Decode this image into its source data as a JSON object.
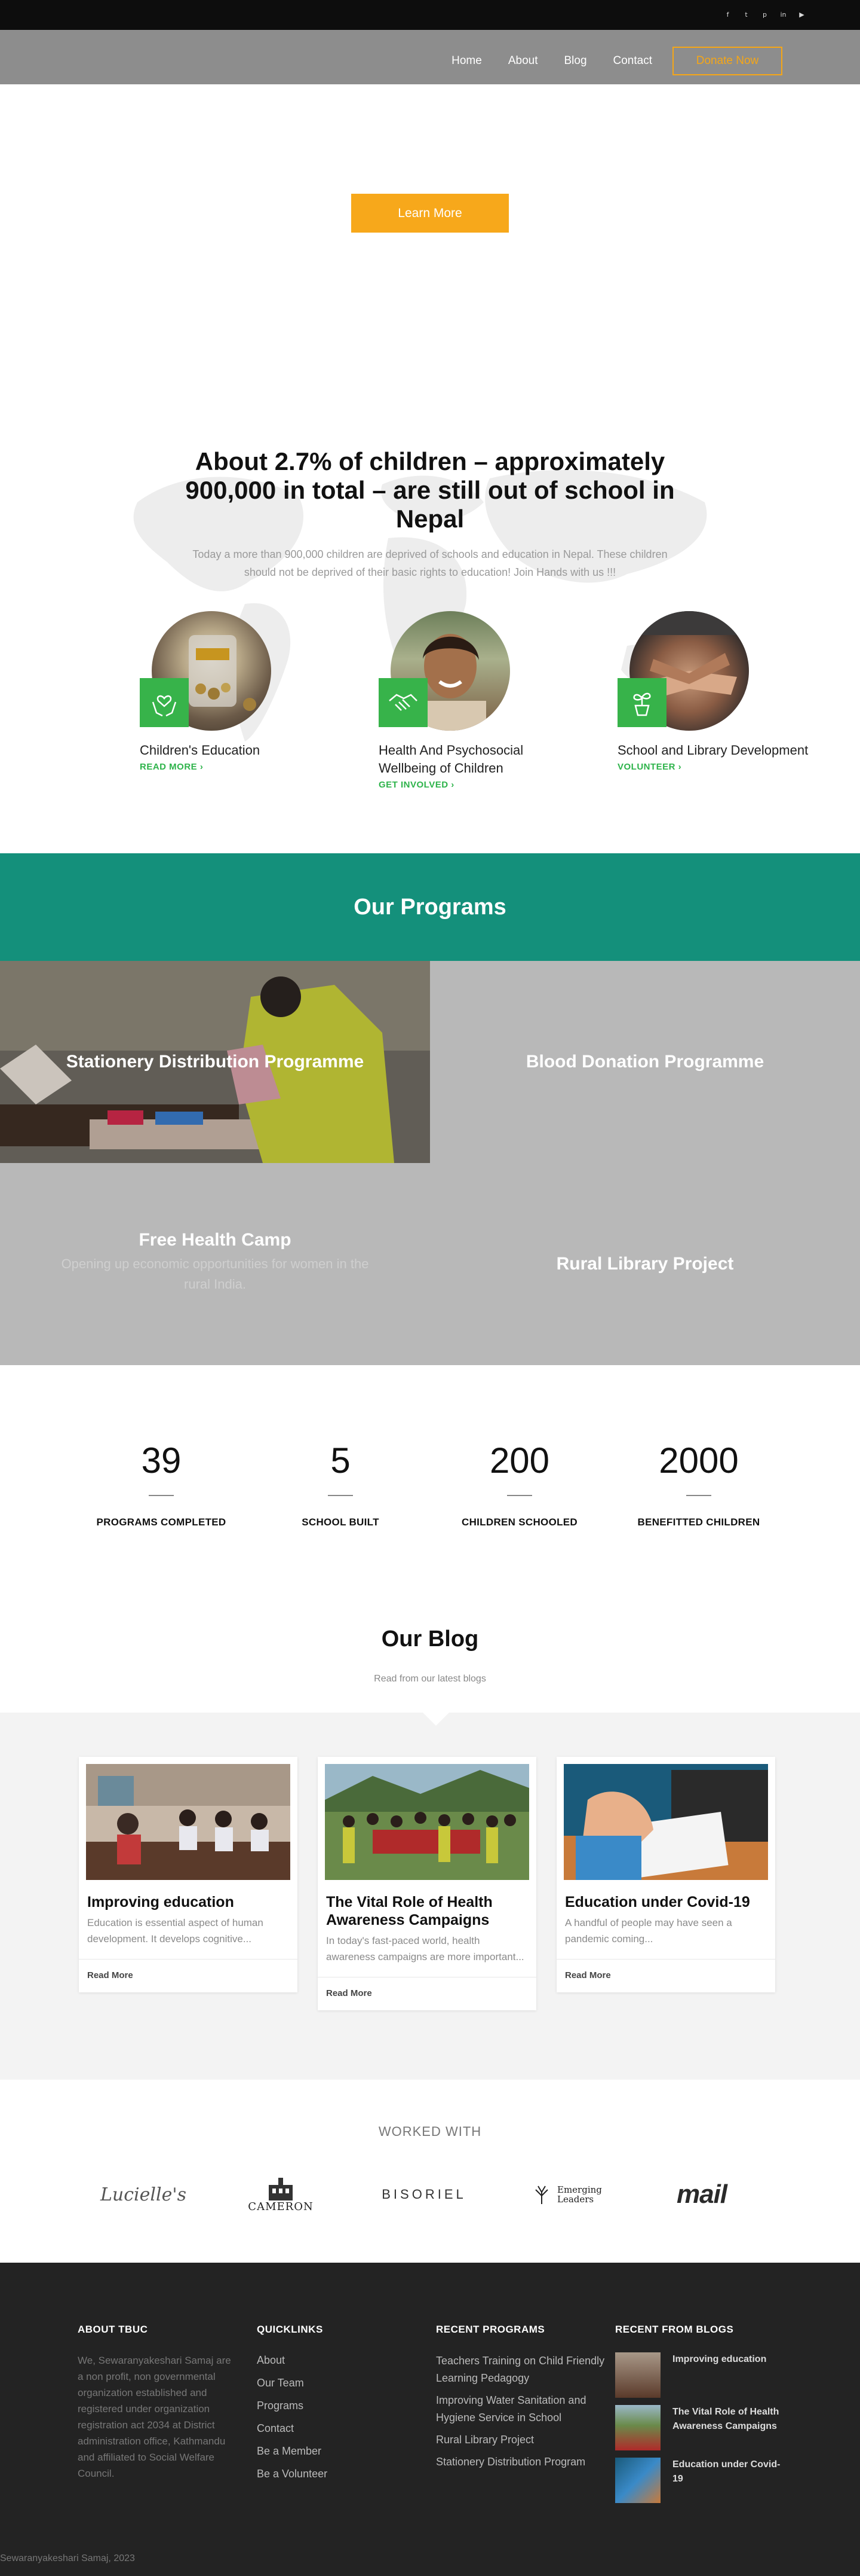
{
  "social_icons": [
    "facebook-icon",
    "twitter-icon",
    "pinterest-icon",
    "linkedin-icon",
    "youtube-icon"
  ],
  "nav": {
    "items": [
      "Home",
      "About",
      "Blog",
      "Contact"
    ],
    "donate_label": "Donate Now"
  },
  "hero": {
    "button_label": "Learn More"
  },
  "about": {
    "title": "About 2.7% of children – approximately 900,000 in total – are still out of school in Nepal",
    "text": "Today a more than 900,000 children are deprived of schools and education in Nepal. These children should not be deprived of their basic rights to education! Join Hands with us !!!"
  },
  "features": [
    {
      "title": "Children's Education",
      "link": "READ MORE ›",
      "icon": "hands-heart-icon"
    },
    {
      "title": "Health And Psychosocial Wellbeing of Children",
      "link": "GET INVOLVED ›",
      "icon": "handshake-icon"
    },
    {
      "title": "School and Library Development",
      "link": "VOLUNTEER ›",
      "icon": "plant-icon"
    }
  ],
  "programs": {
    "heading": "Our Programs",
    "tiles": [
      {
        "title": "Stationery Distribution Programme",
        "subtitle": ""
      },
      {
        "title": "Blood Donation Programme",
        "subtitle": ""
      },
      {
        "title": "Free Health Camp",
        "subtitle": "Opening up economic opportunities for women in the rural India."
      },
      {
        "title": "Rural Library Project",
        "subtitle": ""
      }
    ]
  },
  "stats": [
    {
      "value": "39",
      "label": "PROGRAMS COMPLETED"
    },
    {
      "value": "5",
      "label": "SCHOOL BUILT"
    },
    {
      "value": "200",
      "label": "CHILDREN SCHOOLED"
    },
    {
      "value": "2000",
      "label": "BENEFITTED CHILDREN"
    }
  ],
  "blog": {
    "heading": "Our Blog",
    "subheading": "Read from our latest blogs",
    "posts": [
      {
        "title": "Improving education",
        "excerpt": "Education is essential aspect of human development. It develops cognitive...",
        "more": "Read More"
      },
      {
        "title": "The Vital Role of Health Awareness Campaigns",
        "excerpt": "In today's fast-paced world, health awareness campaigns are more important...",
        "more": "Read More"
      },
      {
        "title": "Education under Covid-19",
        "excerpt": "A handful of people may have seen a pandemic coming...",
        "more": "Read More"
      }
    ]
  },
  "partners": {
    "heading": "WORKED WITH",
    "logos": [
      "Lucielle's",
      "CAMERON",
      "BISORIEL",
      "Emerging Leaders",
      "mail"
    ]
  },
  "footer": {
    "about": {
      "heading": "ABOUT TBUC",
      "text": "We, Sewaranyakeshari Samaj are a non profit, non governmental organization established and registered under organization registration act 2034 at District administration office, Kathmandu and affiliated to Social Welfare Council."
    },
    "quicklinks": {
      "heading": "QUICKLINKS",
      "items": [
        "About",
        "Our Team",
        "Programs",
        "Contact",
        "Be a Member",
        "Be a Volunteer"
      ]
    },
    "recent_programs": {
      "heading": "RECENT PROGRAMS",
      "items": [
        "Teachers Training on Child Friendly Learning Pedagogy",
        "Improving Water Sanitation and Hygiene Service in School",
        "Rural Library Project",
        "Stationery Distribution Program"
      ]
    },
    "recent_blogs": {
      "heading": "RECENT FROM BLOGS",
      "items": [
        "Improving education",
        "The Vital Role of Health Awareness Campaigns",
        "Education under Covid-19"
      ]
    },
    "copyright": "Sewaranyakeshari Samaj, 2023"
  }
}
